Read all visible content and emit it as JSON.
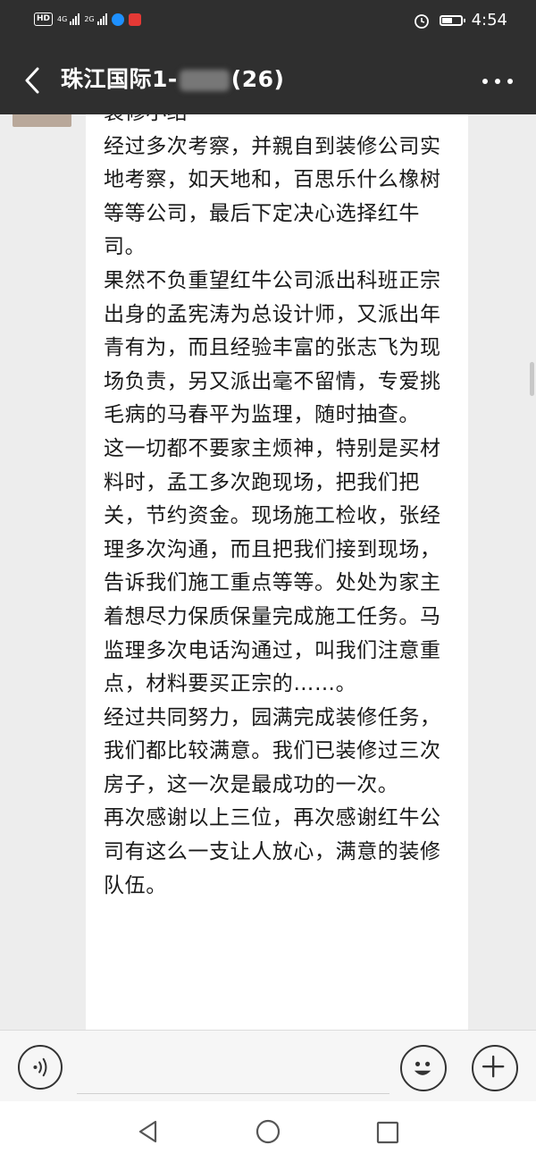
{
  "status_bar": {
    "hd_label": "HD",
    "network_1": "4G",
    "network_2": "2G",
    "time": "4:54",
    "icons": [
      "alarm-icon",
      "battery-icon"
    ]
  },
  "header": {
    "title_prefix": "珠江国际1-",
    "title_suffix": "(26)",
    "back_icon": "chevron-left-icon",
    "more_icon": "more-icon"
  },
  "message": {
    "lines": [
      "装修小结",
      "经过多次考察，并親自到装修公司实地考察，如天地和，百思乐什么橡树等等公司，最后下定决心选择红牛司。",
      "果然不负重望红牛公司派出科班正宗出身的孟宪涛为总设计师，又派出年青有为，而且经验丰富的张志飞为现场负责，另又派出毫不留情，专爱挑毛病的马春平为监理，随时抽查。",
      "这一切都不要家主烦神，特别是买材料时，孟工多次跑现场，把我们把关，节约资金。现场施工检收，张经理多次沟通，而且把我们接到现场，告诉我们施工重点等等。处处为家主着想尽力保质保量完成施工任务。马监理多次电话沟通过，叫我们注意重点，材料要买正宗的……。",
      "经过共同努力，园满完成装修任务，我们都比较满意。我们已装修过三次房子，这一次是最成功的一次。",
      "再次感谢以上三位，再次感谢红牛公司有这么一支让人放心，满意的装修队伍。"
    ]
  },
  "input_bar": {
    "voice_icon": "voice-icon",
    "input_value": "",
    "emoji_icon": "emoji-icon",
    "plus_icon": "plus-icon"
  },
  "nav_bar": {
    "icons": [
      "nav-back-icon",
      "nav-home-icon",
      "nav-recent-icon"
    ]
  },
  "colors": {
    "header_bg": "#2f2f2f",
    "chat_bg": "#ededed",
    "bubble_bg": "#ffffff"
  }
}
